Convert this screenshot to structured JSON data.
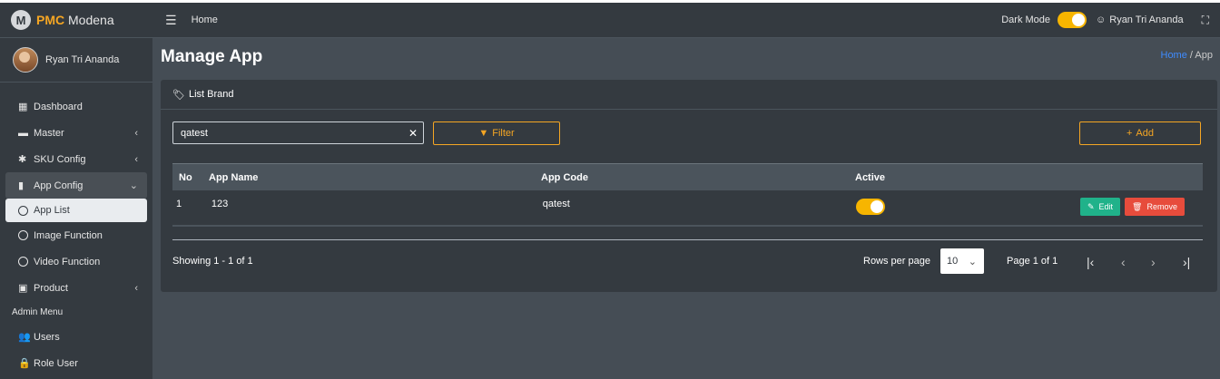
{
  "brand": {
    "logo_letter": "M",
    "name_bold": "PMC",
    "name_rest": " Modena"
  },
  "user": {
    "name": "Ryan Tri Ananda"
  },
  "sidebar": {
    "items": [
      {
        "label": "Dashboard",
        "icon": "grid-icon"
      },
      {
        "label": "Master",
        "icon": "car-icon"
      },
      {
        "label": "SKU Config",
        "icon": "gear-icon"
      },
      {
        "label": "App Config",
        "icon": "phone-icon"
      },
      {
        "label": "App List",
        "icon": "circle-icon"
      },
      {
        "label": "Image Function",
        "icon": "circle-icon"
      },
      {
        "label": "Video Function",
        "icon": "circle-icon"
      },
      {
        "label": "Product",
        "icon": "box-icon"
      }
    ],
    "admin_header": "Admin Menu",
    "admin_items": [
      {
        "label": "Users",
        "icon": "users-icon"
      },
      {
        "label": "Role User",
        "icon": "lock-icon"
      }
    ]
  },
  "topbar": {
    "home": "Home",
    "dark_mode_label": "Dark Mode",
    "dark_mode_on": true,
    "user_name": "Ryan Tri Ananda"
  },
  "page": {
    "title": "Manage App",
    "breadcrumb_home": "Home",
    "breadcrumb_sep": "/",
    "breadcrumb_current": "App"
  },
  "card": {
    "title": "List Brand",
    "search_value": "qatest",
    "filter_label": "Filter",
    "add_label": "Add"
  },
  "table": {
    "headers": {
      "no": "No",
      "name": "App Name",
      "code": "App Code",
      "active": "Active"
    },
    "rows": [
      {
        "no": "1",
        "name": "123",
        "code": "qatest",
        "active": true,
        "edit": "Edit",
        "remove": "Remove"
      }
    ]
  },
  "pagination": {
    "showing": "Showing 1 - 1 of 1",
    "rows_per_page_label": "Rows per page",
    "rows_per_page_value": "10",
    "page_of": "Page 1 of 1"
  },
  "colors": {
    "accent": "#f5a623",
    "toggle": "#f7b500",
    "edit": "#20b28a",
    "remove": "#e74c3c",
    "link": "#3f8cff"
  }
}
